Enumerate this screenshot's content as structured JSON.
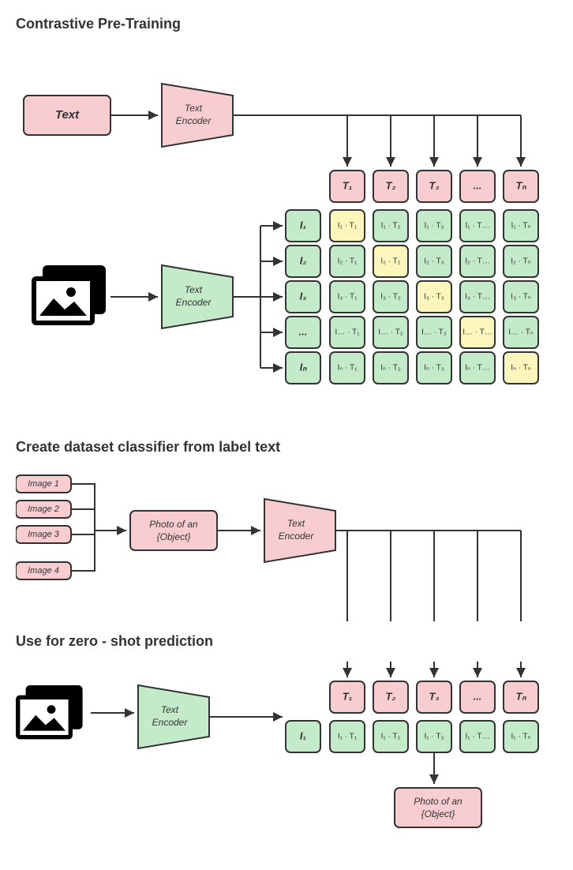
{
  "sections": {
    "s1": {
      "title": "Contrastive Pre-Training"
    },
    "s2": {
      "title": "Create dataset classifier from label text"
    },
    "s3": {
      "title": "Use for zero - shot prediction"
    }
  },
  "labels": {
    "text": "Text",
    "text_encoder_l1": "Text",
    "text_encoder_l2": "Encoder",
    "image1": "Image 1",
    "image2": "Image 2",
    "image3": "Image 3",
    "image4": "Image 4",
    "prompt_l1": "Photo of an",
    "prompt_l2": "{Object}"
  },
  "t_tokens": [
    "T₁",
    "T₂",
    "T₃",
    "...",
    "Tₙ"
  ],
  "i_tokens": [
    "I₁",
    "I₂",
    "I₃",
    "...",
    "Iₙ"
  ],
  "i1_token": "I₁",
  "matrix": [
    [
      "I₁ · T₁",
      "I₁ · T₂",
      "I₁ · T₃",
      "I₁ · T…",
      "I₁ · Tₙ"
    ],
    [
      "I₂ · T₁",
      "I₂ · T₂",
      "I₂ · T₃",
      "I₂ · T…",
      "I₂ · Tₙ"
    ],
    [
      "I₃ · T₁",
      "I₃ · T₂",
      "I₃ · T₃",
      "I₃ · T…",
      "I₃ · Tₙ"
    ],
    [
      "I… · T₁",
      "I… · T₂",
      "I… · T₃",
      "I… · T…",
      "I… · Tₙ"
    ],
    [
      "Iₙ · T₁",
      "Iₙ · T₂",
      "Iₙ · T₃",
      "Iₙ · T…",
      "Iₙ · Tₙ"
    ]
  ],
  "row1": [
    "I₁ · T₁",
    "I₁ · T₂",
    "I₁ · T₃",
    "I₁ · T…",
    "I₁ · Tₙ"
  ]
}
